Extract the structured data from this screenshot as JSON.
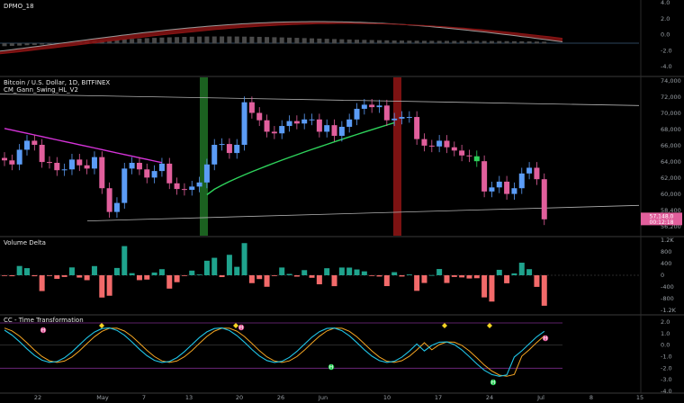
{
  "panes": {
    "dpmo": {
      "title": "DPMO_18",
      "y_ticks": [
        "4.0",
        "2.0",
        "0.0",
        "-2.0",
        "-4.0"
      ]
    },
    "price": {
      "title": "Bitcoin / U.S. Dollar, 1D, BITFINEX",
      "indicator": "CM_Gann_Swing_HL_V2",
      "y_ticks": [
        "74,000",
        "72,000",
        "70,000",
        "68,000",
        "66,000",
        "64,000",
        "62,000",
        "60,000",
        "58,400",
        "56,200"
      ],
      "last_price": "57,148.0",
      "last_countdown": "00:12:18"
    },
    "volume_delta": {
      "title": "Volume Delta",
      "y_ticks": [
        "1.2K",
        "800",
        "400",
        "0",
        "-400",
        "-800",
        "-1.2K"
      ]
    },
    "time_transform": {
      "title": "CC - Time Transformation",
      "y_ticks": [
        "2.0",
        "1.0",
        "0.0",
        "-1.0",
        "-2.0",
        "-3.0",
        "-4.0"
      ]
    }
  },
  "x_axis": [
    "22",
    "May",
    "7",
    "13",
    "20",
    "26",
    "Jun",
    "10",
    "17",
    "24",
    "Jul",
    "8",
    "15"
  ],
  "colors": {
    "background": "#000000",
    "bull": "#5b9cf6",
    "bear": "#e15f9c",
    "gann_high": "#d633d9",
    "gann_low": "#2ed25b",
    "trendline": "#b0b0b0",
    "vd_up": "#1fa38d",
    "vd_down": "#f26a6a",
    "tt_cyan": "#20c4e6",
    "tt_orange": "#f5a623",
    "green_band": "#1e6b24",
    "red_band": "#8a1414",
    "grid": "#2a2a2a"
  },
  "markers": {
    "high": "H",
    "low": "H"
  },
  "chart_data": {
    "type": "candlestick",
    "title": "Bitcoin / U.S. Dollar, 1D, BITFINEX",
    "ohlc_close": [
      64300,
      63800,
      65600,
      66700,
      66200,
      64100,
      64000,
      63100,
      63200,
      64400,
      63700,
      63300,
      64700,
      60900,
      58000,
      59100,
      63300,
      64000,
      63200,
      62200,
      63000,
      63900,
      61500,
      60800,
      60700,
      61100,
      61600,
      63800,
      66200,
      66300,
      65200,
      66200,
      71400,
      70100,
      69200,
      67800,
      67600,
      68500,
      69100,
      68800,
      69300,
      69300,
      67800,
      68600,
      67300,
      68400,
      69300,
      70600,
      71100,
      70800,
      71000,
      69200,
      69400,
      69600,
      69600,
      66900,
      66100,
      66000,
      66700,
      65900,
      65500,
      64900,
      64800,
      64200,
      60500,
      61000,
      61700,
      60200,
      60900,
      62700,
      63400,
      62000,
      57100
    ],
    "gann_high_curve_start": 68200,
    "gann_high_curve_end": 63900,
    "gann_low_curve_start": 60100,
    "gann_low_curve_end": 68900,
    "volume_delta_range": [
      -1200,
      1200
    ],
    "time_transform_range": [
      -4.0,
      2.0
    ]
  }
}
